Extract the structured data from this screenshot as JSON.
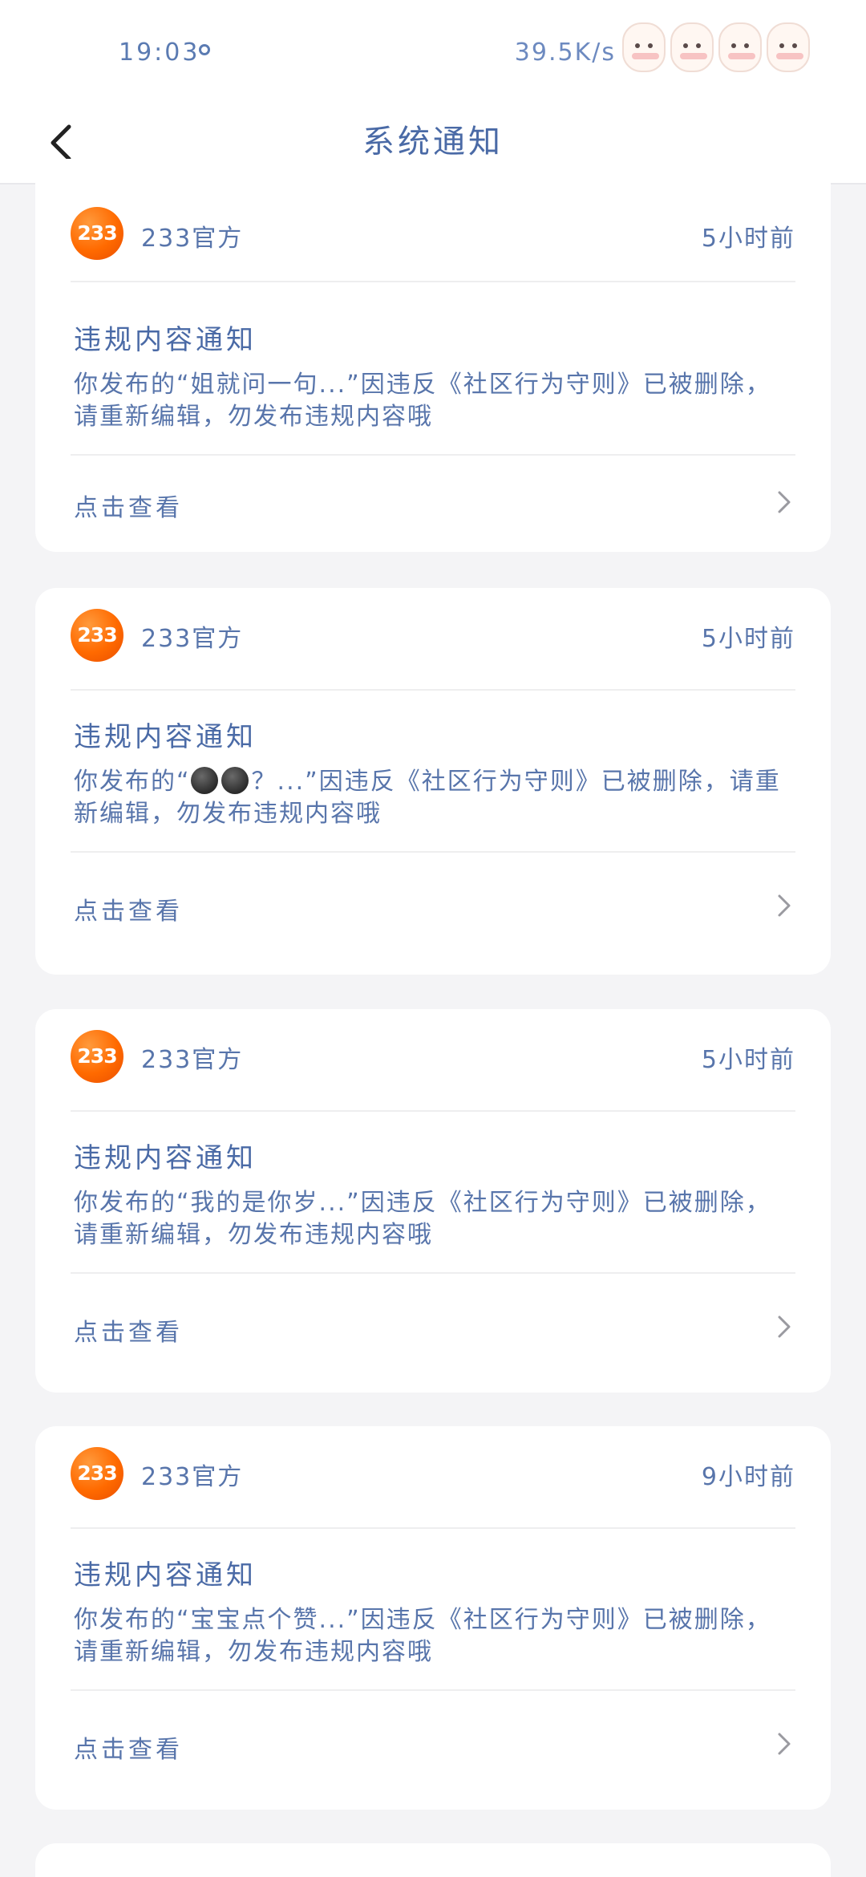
{
  "status_bar": {
    "time": "19:03",
    "network_speed": "39.5K/s",
    "stickers": [
      "bunny-sticker",
      "sheep-sticker",
      "lamb-sticker",
      "goat-sticker"
    ]
  },
  "nav": {
    "title": "系统通知",
    "back_icon": "chevron-left-icon"
  },
  "colors": {
    "accent": "#4a6aa6",
    "logo": "#ff6a00",
    "background": "#f4f4f6"
  },
  "notifications": [
    {
      "logo_text": "233",
      "sender": "233官方",
      "time": "5小时前",
      "title": "违规内容通知",
      "body": "你发布的“姐就问一句...”因违反《社区行为守则》已被删除，请重新编辑，勿发布违规内容哦",
      "link": "点击查看"
    },
    {
      "logo_text": "233",
      "sender": "233官方",
      "time": "5小时前",
      "title": "违规内容通知",
      "body_prefix": "你发布的“",
      "body_emoji": [
        "dark-face-emoji",
        "dark-face-emoji"
      ],
      "body_suffix": "？...”因违反《社区行为守则》已被删除，请重新编辑，勿发布违规内容哦",
      "link": "点击查看"
    },
    {
      "logo_text": "233",
      "sender": "233官方",
      "time": "5小时前",
      "title": "违规内容通知",
      "body": "你发布的“我的是你岁...”因违反《社区行为守则》已被删除，请重新编辑，勿发布违规内容哦",
      "link": "点击查看"
    },
    {
      "logo_text": "233",
      "sender": "233官方",
      "time": "9小时前",
      "title": "违规内容通知",
      "body": "你发布的“宝宝点个赞...”因违反《社区行为守则》已被删除，请重新编辑，勿发布违规内容哦",
      "link": "点击查看"
    }
  ]
}
